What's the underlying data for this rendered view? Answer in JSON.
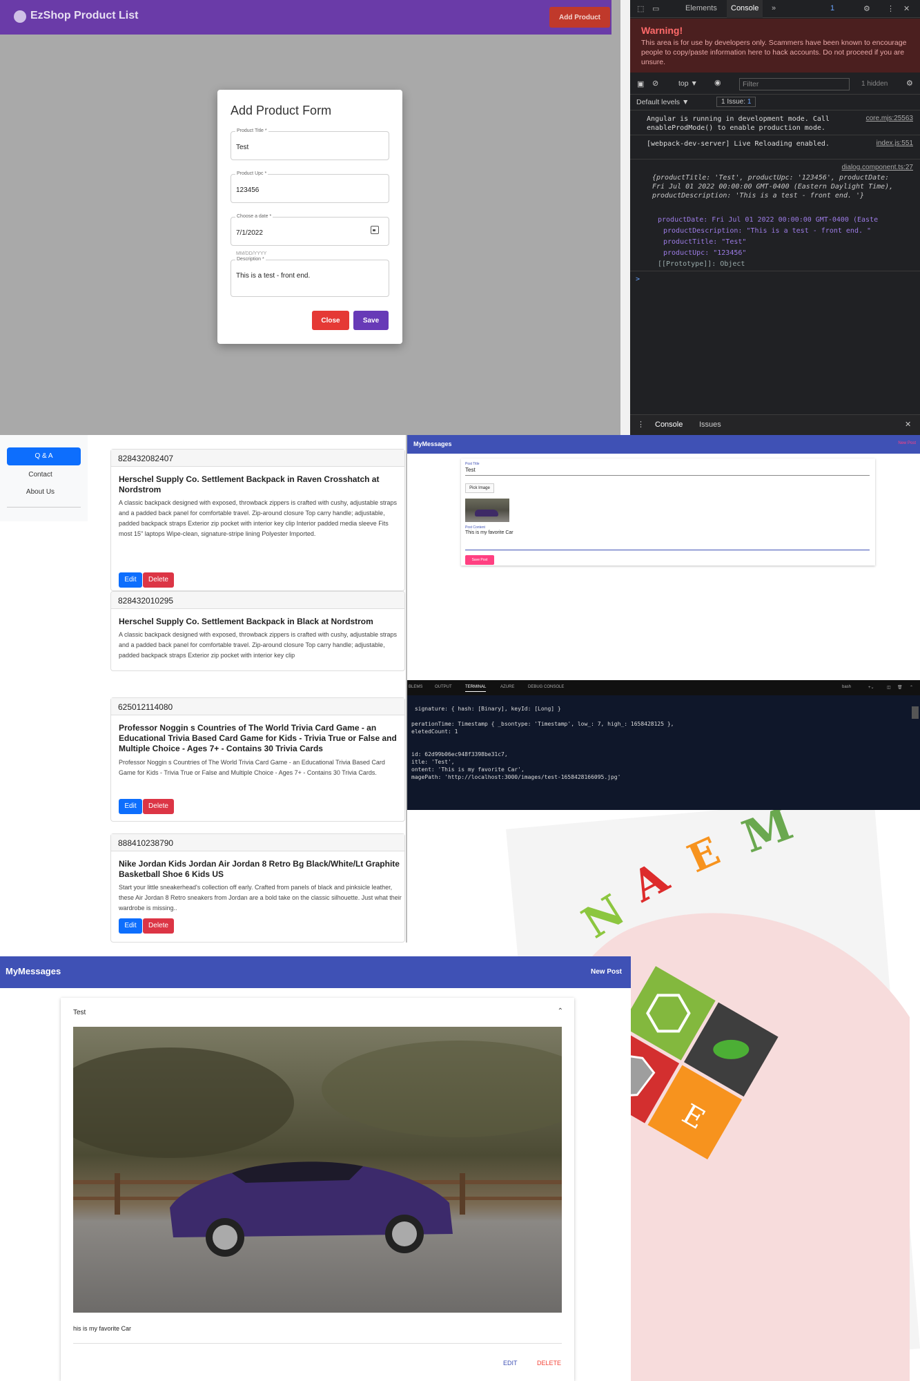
{
  "ezshop": {
    "app_title": "EzShop Product List",
    "add_product": "Add Product",
    "dialog": {
      "title": "Add Product Form",
      "fields": [
        {
          "label": "Product Title *",
          "value": "Test"
        },
        {
          "label": "Product Upc *",
          "value": "123456"
        },
        {
          "label": "Choose a date *",
          "value": "7/1/2022"
        },
        {
          "label": "Description *",
          "value": "This is a test - front end."
        }
      ],
      "date_hint": "MM/DD/YYYY",
      "close": "Close",
      "save": "Save"
    }
  },
  "devtools": {
    "tabs": [
      "Elements",
      "Console"
    ],
    "issues_badge": "1",
    "warning_title": "Warning!",
    "warning_text": "This area is for use by developers only. Scammers have been known to encourage people to copy/paste information here to hack accounts. Do not proceed if you are unsure.",
    "context": "top ▼",
    "filter_placeholder": "Filter",
    "hidden": "1 hidden",
    "levels": "Default levels ▼",
    "issue_count": "1 Issue:",
    "issue_num": "1",
    "messages": [
      {
        "text": "Angular is running in development mode. Call enableProdMode() to enable production mode.",
        "source": "core.mjs:25563"
      },
      {
        "text": "[webpack-dev-server] Live Reloading enabled.",
        "source": "index.js:551"
      }
    ],
    "log_source": "dialog.component.ts:27",
    "log_preview": "{productTitle: 'Test', productUpc: '123456', productDate: Fri Jul 01 2022 00:00:00 GMT-0400 (Eastern Daylight Time), productDescription: 'This is a test - front end. '}",
    "props": [
      "productDate: Fri Jul 01 2022 00:00:00 GMT-0400 (Easte",
      "productDescription: \"This is a test - front end. \"",
      "productTitle: \"Test\"",
      "productUpc: \"123456\"",
      "[[Prototype]]: Object"
    ],
    "prompt": ">",
    "bottom_tabs": [
      "Console",
      "Issues"
    ]
  },
  "products": {
    "nav": [
      "Q & A",
      "Contact",
      "About Us"
    ],
    "cards": [
      {
        "upc": "828432082407",
        "title": "Herschel Supply Co. Settlement Backpack in Raven Crosshatch at Nordstrom",
        "desc": "A classic backpack designed with exposed, throwback zippers is crafted with cushy, adjustable straps and a padded back panel for comfortable travel. Zip-around closure Top carry handle; adjustable, padded backpack straps Exterior zip pocket with interior key clip Interior padded media sleeve Fits most 15\" laptops Wipe-clean, signature-stripe lining Polyester Imported."
      },
      {
        "upc": "828432010295",
        "title": "Herschel Supply Co. Settlement Backpack in Black at Nordstrom",
        "desc": "A classic backpack designed with exposed, throwback zippers is crafted with cushy, adjustable straps and a padded back panel for comfortable travel. Zip-around closure Top carry handle; adjustable, padded backpack straps Exterior zip pocket with interior key clip"
      },
      {
        "upc": "625012114080",
        "title": "Professor Noggin s Countries of The World Trivia Card Game - an Educational Trivia Based Card Game for Kids - Trivia True or False and Multiple Choice - Ages 7+ - Contains 30 Trivia Cards",
        "desc": "Professor Noggin s Countries of The World Trivia Card Game - an Educational Trivia Based Card Game for Kids - Trivia True or False and Multiple Choice - Ages 7+ - Contains 30 Trivia Cards."
      },
      {
        "upc": "888410238790",
        "title": "Nike Jordan Kids Jordan Air Jordan 8 Retro Bg Black/White/Lt Graphite Basketball Shoe 6 Kids US",
        "desc": "Start your little sneakerhead's collection off early. Crafted from panels of black and pinksicle leather, these Air Jordan 8 Retro sneakers from Jordan are a bold take on the classic silhouette. Just what their wardrobe is missing.."
      }
    ],
    "edit": "Edit",
    "delete": "Delete"
  },
  "messages_small": {
    "app_title": "MyMessages",
    "new_post": "New Post",
    "post_title_label": "Post Title",
    "post_title_value": "Test",
    "pick_image": "Pick Image",
    "post_content_label": "Post Content",
    "post_content_value": "This is my favorite Car",
    "save_post": "Save Post"
  },
  "terminal": {
    "tabs": [
      "BLEMS",
      "OUTPUT",
      "TERMINAL",
      "AZURE",
      "DEBUG CONSOLE"
    ],
    "shell": "bash",
    "lines": [
      " signature: { hash: [Binary], keyId: [Long] }",
      "",
      "perationTime: Timestamp { _bsontype: 'Timestamp', low_: 7, high_: 1658428125 },",
      "eletedCount: 1",
      "",
      "",
      "id: 62d99b06ec948f3398be31c7,",
      "itle: 'Test',",
      "ontent: 'This is my favorite Car',",
      "magePath: 'http://localhost:3000/images/test-1658428166095.jpg'"
    ]
  },
  "mean": {
    "letters": [
      "N",
      "A",
      "E",
      "M"
    ],
    "colors": {
      "n": "#8cc63f",
      "a": "#dd2c2c",
      "e": "#f7931e",
      "m": "#6aa84f"
    }
  },
  "messages_big": {
    "app_title": "MyMessages",
    "new_post": "New Post",
    "post_title": "Test",
    "post_content": "his is my favorite Car",
    "edit": "EDIT",
    "delete": "DELETE"
  }
}
